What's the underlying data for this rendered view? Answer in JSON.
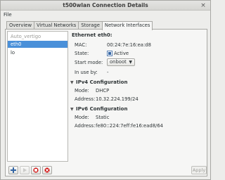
{
  "window": {
    "title": "t500wlan Connection Details",
    "close_glyph": "×"
  },
  "menubar": {
    "file": "File"
  },
  "tabs": [
    {
      "label": "Overview"
    },
    {
      "label": "Virtual Networks"
    },
    {
      "label": "Storage"
    },
    {
      "label": "Network Interfaces"
    }
  ],
  "interfaces": [
    {
      "label": "Auto_vertigo",
      "state": "dim"
    },
    {
      "label": "eth0",
      "state": "selected"
    },
    {
      "label": "lo",
      "state": "normal"
    }
  ],
  "details": {
    "heading": "Ethernet eth0:",
    "mac_label": "MAC:",
    "mac_value": "00:24:7e:16:ea:d8",
    "state_label": "State:",
    "state_value": "Active",
    "start_mode_label": "Start mode:",
    "start_mode_value": "onboot",
    "in_use_label": "In use by:",
    "in_use_value": "-",
    "ipv4": {
      "title": "IPv4 Configuration",
      "mode_label": "Mode:",
      "mode_value": "DHCP",
      "address_label": "Address:",
      "address_value": "10.32.224.199/24"
    },
    "ipv6": {
      "title": "IPv6 Configuration",
      "mode_label": "Mode:",
      "mode_value": "Static",
      "address_label": "Address:",
      "address_value": "fe80::224:7eff:fe16:ead8/64"
    }
  },
  "buttons": {
    "apply": "Apply"
  },
  "icons": {
    "add": "add-icon",
    "start": "play-icon",
    "stop": "stop-icon",
    "delete": "delete-icon",
    "active": "active-status-icon"
  },
  "colors": {
    "selection": "#4a90d9",
    "add_blue": "#3465a4",
    "delete_red": "#cc0000",
    "active_blue": "#3465a4"
  }
}
